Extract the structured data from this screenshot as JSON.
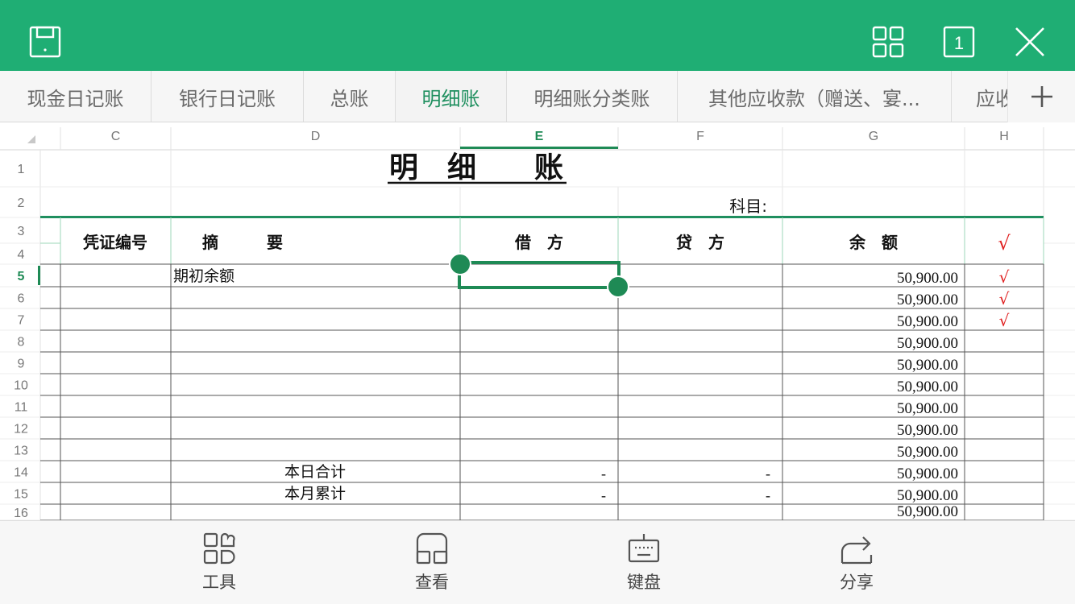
{
  "colors": {
    "accent": "#1fae74",
    "active_tab_text": "#1f8f5f",
    "selection": "#1e8a55",
    "check_mark": "#e02020"
  },
  "topbar": {
    "save_icon": "save-icon",
    "grid_icon": "grid-icon",
    "sheet_count": "1",
    "close_icon": "close-icon"
  },
  "tabs": [
    {
      "label": "现金日记账",
      "active": false
    },
    {
      "label": "银行日记账",
      "active": false
    },
    {
      "label": "总账",
      "active": false
    },
    {
      "label": "明细账",
      "active": true
    },
    {
      "label": "明细账分类账",
      "active": false
    },
    {
      "label": "其他应收款（赠送、宴...",
      "active": false
    },
    {
      "label": "应收",
      "active": false
    }
  ],
  "sheet": {
    "col_headers": [
      "C",
      "D",
      "E",
      "F",
      "G",
      "H"
    ],
    "selected_col": "E",
    "row_numbers": [
      "1",
      "2",
      "3",
      "4",
      "5",
      "6",
      "7",
      "8",
      "9",
      "10",
      "11",
      "12",
      "13",
      "14",
      "15",
      "16"
    ],
    "selected_row": "5",
    "title": "明　细　　账",
    "subject_label": "科目:",
    "headers": {
      "voucher": "凭证编号",
      "summary": "摘　　　要",
      "debit": "借　方",
      "credit": "贷　方",
      "balance": "余　额",
      "check": "√"
    },
    "rows": [
      {
        "summary": "期初余额",
        "debit": "",
        "credit": "",
        "balance": "50,900.00",
        "check": "√"
      },
      {
        "summary": "",
        "debit": "",
        "credit": "",
        "balance": "50,900.00",
        "check": "√"
      },
      {
        "summary": "",
        "debit": "",
        "credit": "",
        "balance": "50,900.00",
        "check": "√"
      },
      {
        "summary": "",
        "debit": "",
        "credit": "",
        "balance": "50,900.00",
        "check": ""
      },
      {
        "summary": "",
        "debit": "",
        "credit": "",
        "balance": "50,900.00",
        "check": ""
      },
      {
        "summary": "",
        "debit": "",
        "credit": "",
        "balance": "50,900.00",
        "check": ""
      },
      {
        "summary": "",
        "debit": "",
        "credit": "",
        "balance": "50,900.00",
        "check": ""
      },
      {
        "summary": "",
        "debit": "",
        "credit": "",
        "balance": "50,900.00",
        "check": ""
      },
      {
        "summary": "",
        "debit": "",
        "credit": "",
        "balance": "50,900.00",
        "check": ""
      },
      {
        "summary": "本日合计",
        "debit": "-",
        "credit": "-",
        "balance": "50,900.00",
        "check": ""
      },
      {
        "summary": "本月累计",
        "debit": "-",
        "credit": "-",
        "balance": "50,900.00",
        "check": ""
      },
      {
        "summary": "",
        "debit": "",
        "credit": "",
        "balance": "50,900.00",
        "check": ""
      }
    ]
  },
  "bottombar": [
    {
      "label": "工具",
      "icon": "tools-icon"
    },
    {
      "label": "查看",
      "icon": "view-icon"
    },
    {
      "label": "键盘",
      "icon": "keyboard-icon"
    },
    {
      "label": "分享",
      "icon": "share-icon"
    }
  ]
}
